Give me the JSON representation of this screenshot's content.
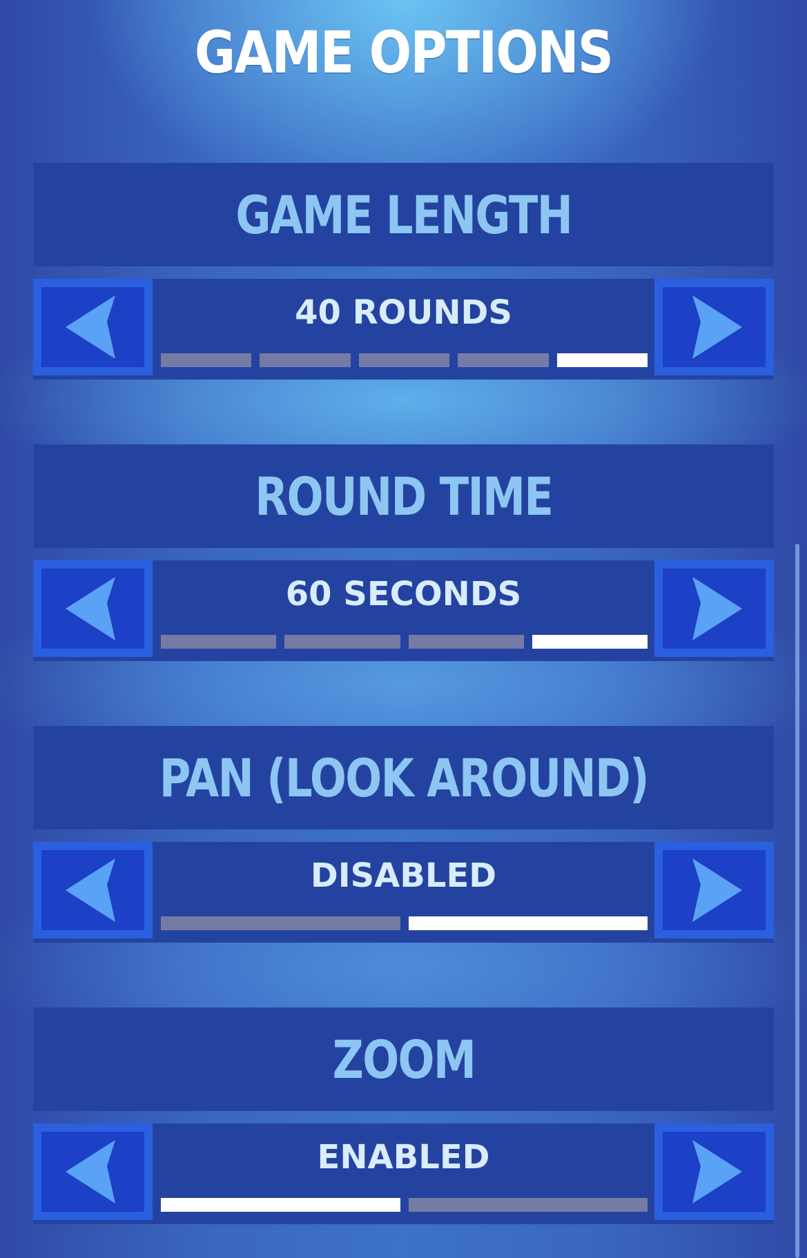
{
  "title": "GAME OPTIONS",
  "options": [
    {
      "id": "game-length",
      "header": "GAME LENGTH",
      "value": "40 ROUNDS",
      "steps": 5,
      "selected_step": 5
    },
    {
      "id": "round-time",
      "header": "ROUND TIME",
      "value": "60 SECONDS",
      "steps": 4,
      "selected_step": 4
    },
    {
      "id": "pan",
      "header": "PAN (LOOK AROUND)",
      "value": "DISABLED",
      "steps": 2,
      "selected_step": 2
    },
    {
      "id": "zoom",
      "header": "ZOOM",
      "value": "ENABLED",
      "steps": 2,
      "selected_step": 1
    }
  ],
  "icons": {
    "prev": "chevron-left-icon",
    "next": "chevron-right-icon"
  },
  "colors": {
    "title": "#ffffff",
    "header_text": "#8ec6f3",
    "value_text": "#d8ecfb",
    "panel": "#2443a0",
    "button_fill": "#1c40c6",
    "button_border": "#2a5fe0",
    "arrow": "#5aa2f5",
    "segment_active": "#ffffff",
    "segment_inactive": "#767ba6"
  }
}
